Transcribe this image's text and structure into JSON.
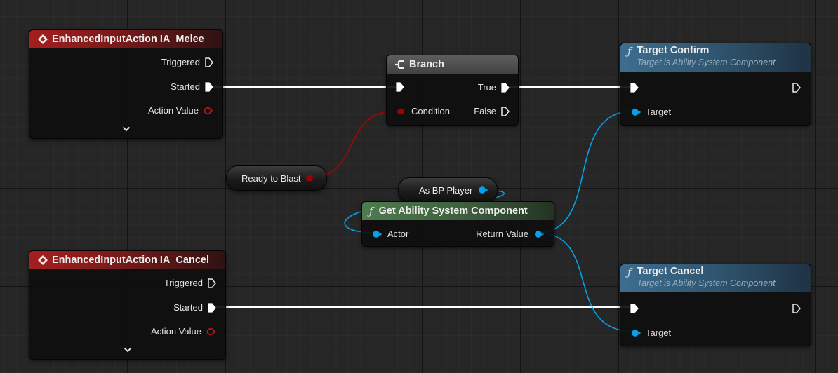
{
  "colors": {
    "exec_wire": "#ffffff",
    "bool_pin": "#9c0000",
    "object_pin": "#04a1ec",
    "event_header": "#a51f1f",
    "function_header": "#3e6d8f",
    "pure_function_header": "#4f7b4f",
    "branch_header": "#5e5e5e"
  },
  "nodes": {
    "melee_event": {
      "title": "EnhancedInputAction IA_Melee",
      "icon": "event-diamond-icon",
      "pins": {
        "triggered": "Triggered",
        "started": "Started",
        "action_value": "Action Value"
      },
      "expand_icon": "chevron-down-icon"
    },
    "cancel_event": {
      "title": "EnhancedInputAction IA_Cancel",
      "icon": "event-diamond-icon",
      "pins": {
        "triggered": "Triggered",
        "started": "Started",
        "action_value": "Action Value"
      },
      "expand_icon": "chevron-down-icon"
    },
    "branch": {
      "title": "Branch",
      "icon": "branch-icon",
      "pins": {
        "condition": "Condition",
        "true": "True",
        "false": "False"
      }
    },
    "ready_to_blast": {
      "label": "Ready to Blast"
    },
    "as_bp_player": {
      "label": "As BP Player"
    },
    "get_asc": {
      "title": "Get Ability System Component",
      "icon": "function-icon",
      "pins": {
        "actor": "Actor",
        "return_value": "Return Value"
      }
    },
    "target_confirm": {
      "title": "Target Confirm",
      "subtitle": "Target is Ability System Component",
      "icon": "function-icon",
      "pins": {
        "target": "Target"
      }
    },
    "target_cancel": {
      "title": "Target Cancel",
      "subtitle": "Target is Ability System Component",
      "icon": "function-icon",
      "pins": {
        "target": "Target"
      }
    }
  }
}
